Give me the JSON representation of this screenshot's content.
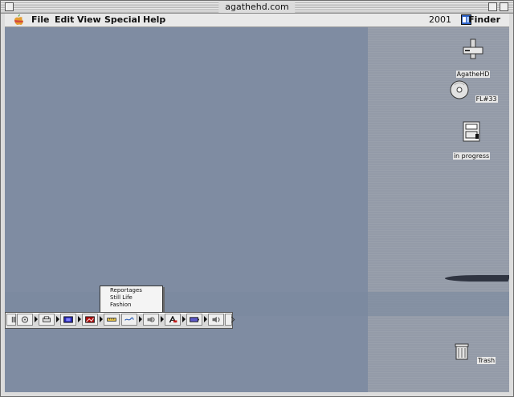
{
  "window": {
    "title": "agathehd.com"
  },
  "menubar": {
    "items": [
      "File",
      "Edit",
      "View",
      "Special",
      "Help"
    ],
    "clock": "2001",
    "active_app": "Finder"
  },
  "desktop": {
    "icons": [
      {
        "name": "AgatheHD",
        "icon": "hard-drive-icon"
      },
      {
        "name": "FL#33",
        "icon": "cd-icon"
      },
      {
        "name": "in progress",
        "icon": "zip-disk-icon"
      },
      {
        "name": "Trash",
        "icon": "trash-icon"
      }
    ]
  },
  "popup_menu": {
    "items": [
      "Reportages",
      "Still Life",
      "Fashion"
    ]
  },
  "control_strip": {
    "modules": [
      {
        "icon": "strip-toggle-icon"
      },
      {
        "icon": "cd-player-icon"
      },
      {
        "icon": "printer-icon"
      },
      {
        "icon": "monitor-icon"
      },
      {
        "icon": "image-icon"
      },
      {
        "icon": "ruler-icon"
      },
      {
        "icon": "network-icon"
      },
      {
        "icon": "speaker-icon"
      },
      {
        "icon": "font-icon"
      },
      {
        "icon": "battery-icon"
      },
      {
        "icon": "volume-icon"
      },
      {
        "icon": "strip-end-icon"
      }
    ]
  }
}
